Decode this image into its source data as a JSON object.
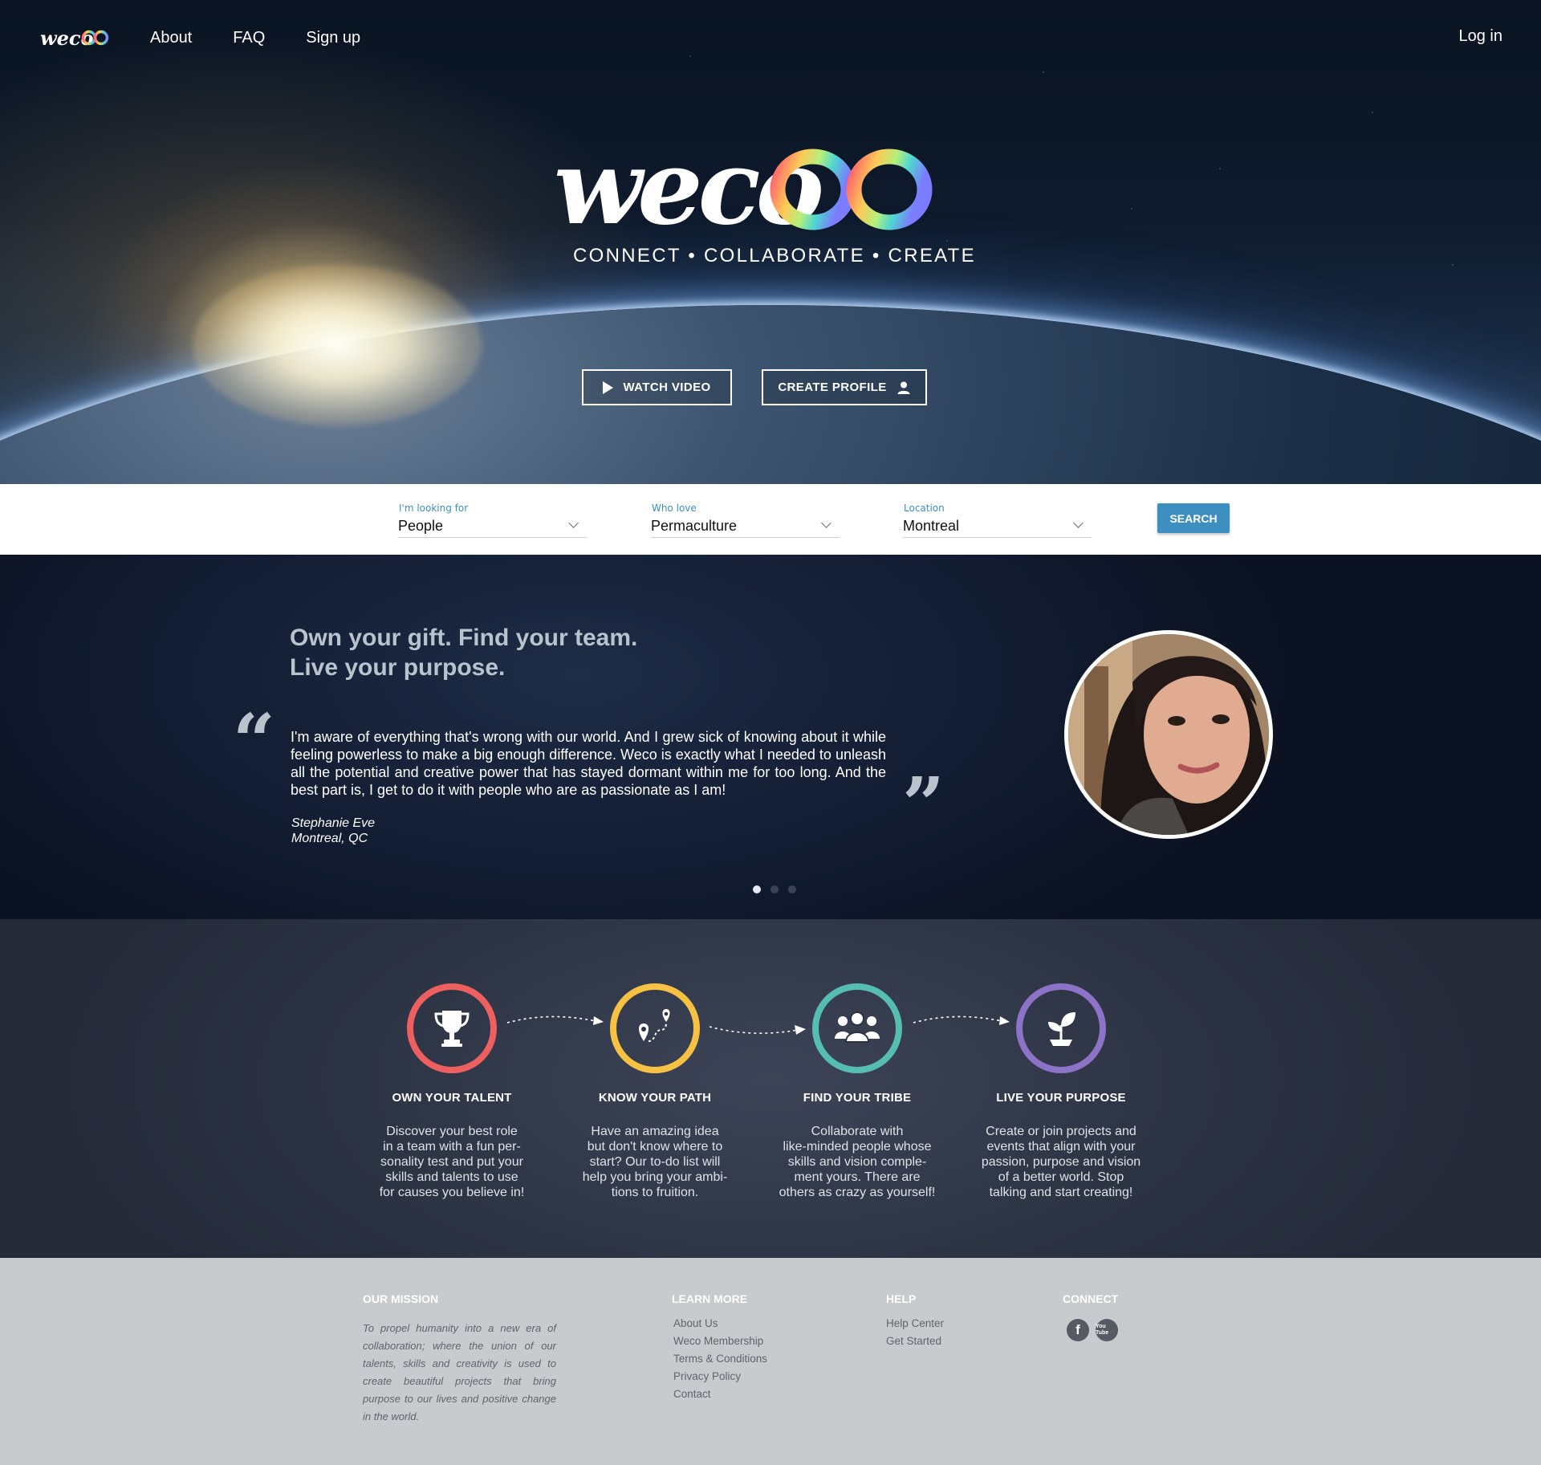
{
  "nav": {
    "logo_text": "weco",
    "links": [
      "About",
      "FAQ",
      "Sign up"
    ],
    "login": "Log in"
  },
  "hero": {
    "logo_text": "weco",
    "tagline": "CONNECT • COLLABORATE • CREATE",
    "watch_video": "WATCH VIDEO",
    "create_profile": "CREATE PROFILE"
  },
  "search": {
    "fields": [
      {
        "label": "I'm looking for",
        "value": "People"
      },
      {
        "label": "Who love",
        "value": "Permaculture"
      },
      {
        "label": "Location",
        "value": "Montreal"
      }
    ],
    "button": "SEARCH"
  },
  "testimonial": {
    "headline_line1": "Own your gift. Find your team.",
    "headline_line2": "Live your purpose.",
    "quote": "I'm aware of everything that's wrong with our world. And I grew sick of knowing about it while feeling powerless to make a big enough difference. Weco is exactly what I needed to unleash all the potential and creative power that has stayed dormant within me for too long. And the best part is, I get to do it with people who are as passionate as I am!",
    "author_name": "Stephanie Eve",
    "author_location": "Montreal, QC",
    "slides": 3,
    "active_slide": 1
  },
  "steps": [
    {
      "title": "OWN YOUR TALENT",
      "icon": "trophy-icon",
      "color": "#ee5f5f",
      "desc_lines": [
        "Discover your best role",
        "in a team with a fun per-",
        "sonality test and put your",
        "skills and talents to use",
        "for causes you believe in!"
      ]
    },
    {
      "title": "KNOW YOUR PATH",
      "icon": "path-pins-icon",
      "color": "#f7c244",
      "desc_lines": [
        "Have an amazing idea",
        "but don't know where to",
        "start? Our to-do list will",
        "help you bring your ambi-",
        "tions to fruition."
      ]
    },
    {
      "title": "FIND YOUR TRIBE",
      "icon": "group-icon",
      "color": "#56bdb3",
      "desc_lines": [
        "Collaborate with",
        "like-minded people whose",
        "skills and vision comple-",
        "ment yours. There are",
        "others as crazy as yourself!"
      ]
    },
    {
      "title": "LIVE YOUR PURPOSE",
      "icon": "sprout-icon",
      "color": "#8d73c8",
      "desc_lines": [
        "Create or join projects and",
        "events that align with your",
        "passion, purpose and vision",
        "of a better world. Stop",
        "talking and start creating!"
      ]
    }
  ],
  "footer": {
    "mission": {
      "heading": "OUR MISSION",
      "text": "To propel humanity into a new era of collaboration; where the union of our talents, skills and creativity is used to create beautiful projects that bring purpose to our lives and positive change in the world."
    },
    "learn_more": {
      "heading": "LEARN MORE",
      "links": [
        "About Us",
        "Weco Membership",
        "Terms & Conditions",
        "Privacy Policy",
        "Contact"
      ]
    },
    "help": {
      "heading": "HELP",
      "links": [
        "Help Center",
        "Get Started"
      ]
    },
    "connect": {
      "heading": "CONNECT",
      "icons": [
        "facebook-icon",
        "youtube-icon"
      ],
      "youtube_text": "You Tube"
    }
  },
  "colors": {
    "accent_blue": "#3d8fc2",
    "talent_red": "#ee5f5f",
    "path_yellow": "#f7c244",
    "tribe_teal": "#56bdb3",
    "purpose_purple": "#8d73c8"
  }
}
